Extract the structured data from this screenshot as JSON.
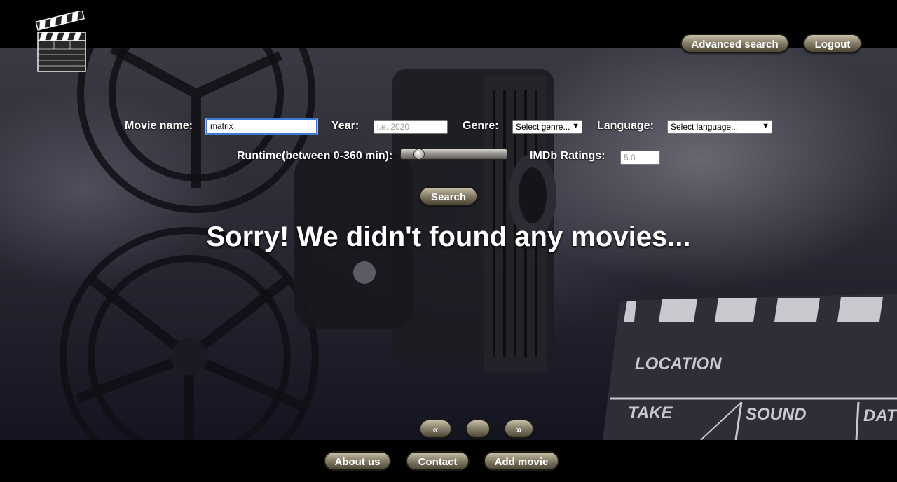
{
  "header": {
    "advanced_search_label": "Advanced search",
    "logout_label": "Logout"
  },
  "search_form": {
    "movie_name": {
      "label": "Movie name:",
      "value": "matrix"
    },
    "year": {
      "label": "Year:",
      "placeholder": "i.e. 2020"
    },
    "genre": {
      "label": "Genre:",
      "selected": "Select genre..."
    },
    "language": {
      "label": "Language:",
      "selected": "Select language..."
    },
    "runtime": {
      "label": "Runtime(between 0-360 min):",
      "value_fraction": 0.12
    },
    "imdb": {
      "label": "IMDb Ratings:",
      "placeholder": "5.0"
    },
    "search_label": "Search"
  },
  "result_message": "Sorry! We didn't found any movies...",
  "pagination": {
    "prev_label": "«",
    "page_label": "",
    "next_label": "»"
  },
  "background": {
    "clapper_words": [
      "LOCATION",
      "TAKE",
      "SOUND",
      "DAT"
    ]
  },
  "footer": {
    "about_label": "About us",
    "contact_label": "Contact",
    "add_movie_label": "Add movie"
  },
  "colors": {
    "button_gradient_top": "#c9c0a8",
    "button_gradient_bottom": "#4c4636",
    "focus": "#3d7ad6"
  }
}
